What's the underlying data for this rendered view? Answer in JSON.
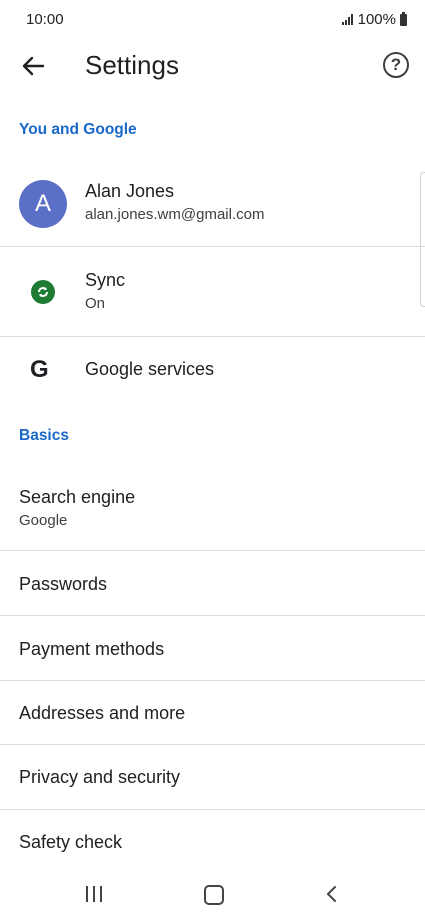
{
  "status_bar": {
    "time": "10:00",
    "battery": "100%"
  },
  "app_bar": {
    "title": "Settings",
    "back_icon": "arrow-left-icon",
    "help_icon": "help-icon",
    "help_glyph": "?"
  },
  "sections": {
    "you_and_google": "You and Google",
    "basics": "Basics"
  },
  "account": {
    "avatar_letter": "A",
    "name": "Alan Jones",
    "email": "alan.jones.wm@gmail.com"
  },
  "sync": {
    "label": "Sync",
    "status": "On"
  },
  "google_services": {
    "icon_letter": "G",
    "label": "Google services"
  },
  "basics_items": {
    "search_engine": {
      "label": "Search engine",
      "value": "Google"
    },
    "passwords": "Passwords",
    "payment_methods": "Payment methods",
    "addresses": "Addresses and more",
    "privacy": "Privacy and security",
    "safety": "Safety check"
  },
  "colors": {
    "accent": "#1a68c9",
    "avatar_bg": "#5b6fc7",
    "sync_green": "#1e7b34"
  }
}
